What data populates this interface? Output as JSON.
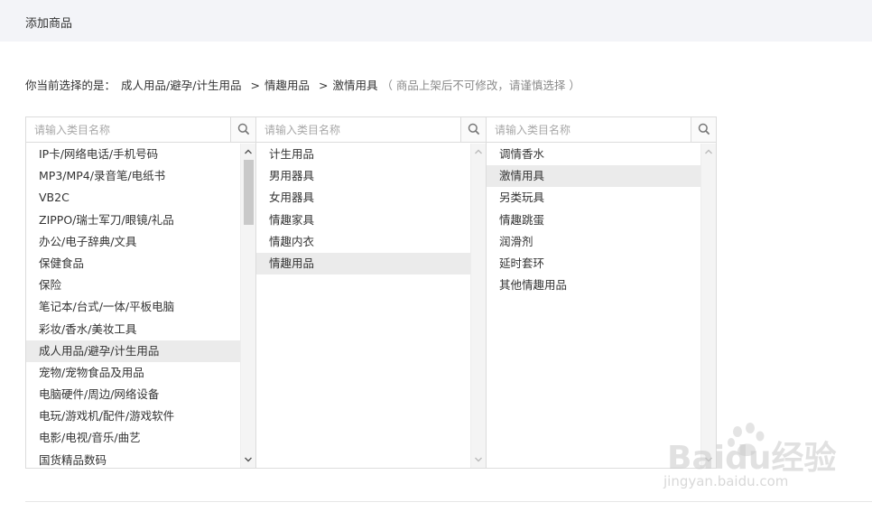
{
  "header": {
    "title": "添加商品"
  },
  "selection": {
    "prefix": "你当前选择的是：",
    "path": [
      "成人用品/避孕/计生用品",
      "情趣用品",
      "激情用具"
    ],
    "separator": ">",
    "hint": "（ 商品上架后不可修改，请谨慎选择 ）"
  },
  "panels": [
    {
      "search_placeholder": "请输入类目名称",
      "items": [
        "IP卡/网络电话/手机号码",
        "MP3/MP4/录音笔/电纸书",
        "VB2C",
        "ZIPPO/瑞士军刀/眼镜/礼品",
        "办公/电子辞典/文具",
        "保健食品",
        "保险",
        "笔记本/台式/一体/平板电脑",
        "彩妆/香水/美妆工具",
        "成人用品/避孕/计生用品",
        "宠物/宠物食品及用品",
        "电脑硬件/周边/网络设备",
        "电玩/游戏机/配件/游戏软件",
        "电影/电视/音乐/曲艺",
        "国货精品数码"
      ],
      "selected_index": 9
    },
    {
      "search_placeholder": "请输入类目名称",
      "items": [
        "计生用品",
        "男用器具",
        "女用器具",
        "情趣家具",
        "情趣内衣",
        "情趣用品"
      ],
      "selected_index": 5
    },
    {
      "search_placeholder": "请输入类目名称",
      "items": [
        "调情香水",
        "激情用具",
        "另类玩具",
        "情趣跳蛋",
        "润滑剂",
        "延时套环",
        "其他情趣用品"
      ],
      "selected_index": 1
    }
  ],
  "watermark": {
    "brand": "Baidu经验",
    "url": "jingyan.baidu.com"
  },
  "icons": {
    "search": "search-icon",
    "scroll_up": "chevron-up-icon",
    "scroll_down": "chevron-down-icon"
  },
  "colors": {
    "header_bg": "#f3f4f8",
    "selected_bg": "#ebebeb",
    "border": "#dcdcdc"
  }
}
